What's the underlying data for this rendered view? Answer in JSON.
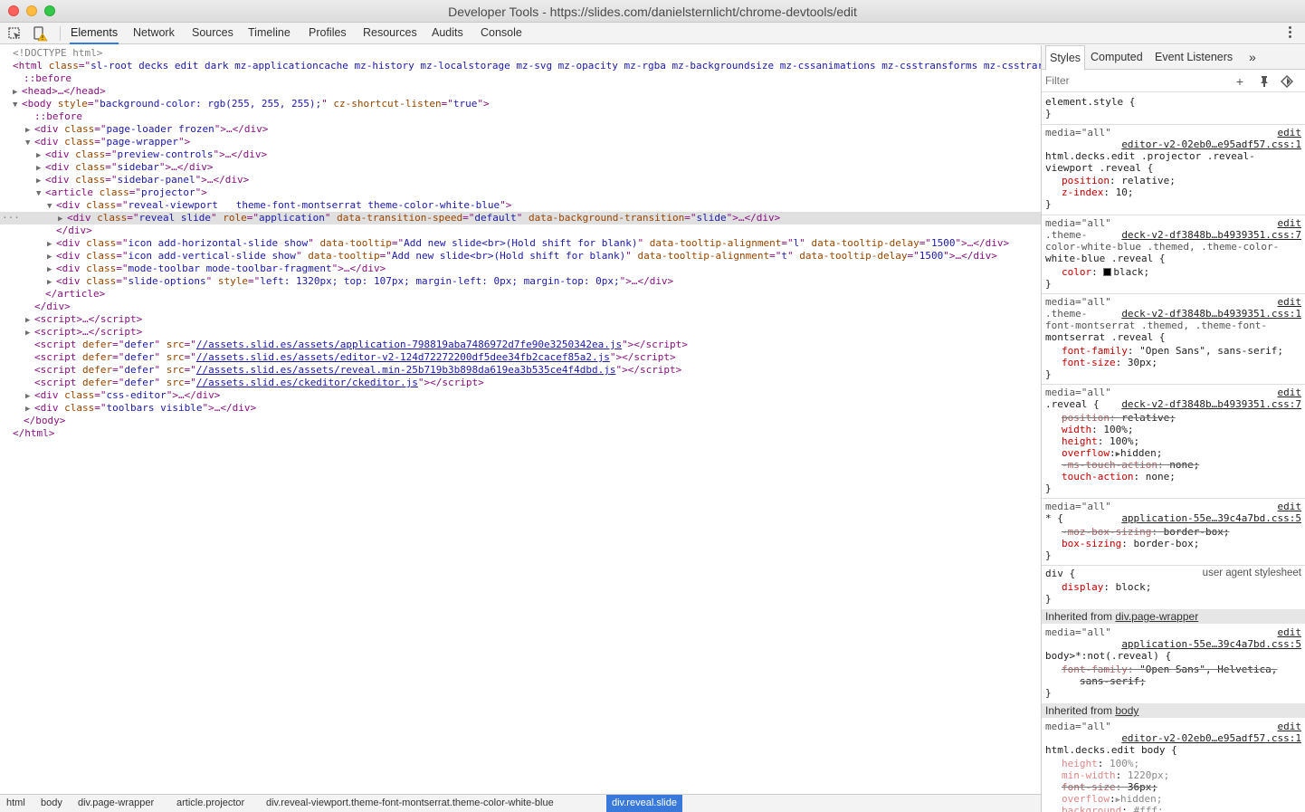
{
  "window": {
    "title": "Developer Tools - https://slides.com/danielsternlicht/chrome-devtools/edit"
  },
  "toolbar": {
    "tabs": [
      "Elements",
      "Network",
      "Sources",
      "Timeline",
      "Profiles",
      "Resources",
      "Audits",
      "Console"
    ],
    "active_tab": "Elements"
  },
  "dom": {
    "doctype": "<!DOCTYPE html>",
    "html_class": "sl-root decks edit dark mz-applicationcache mz-history mz-localstorage mz-svg mz-opacity mz-rgba mz-backgroundsize mz-cssanimations mz-csstransforms mz-csstrar",
    "before": "::before",
    "body_style": "background-color: rgb(255, 255, 255);",
    "body_attr2_name": "cz-shortcut-listen",
    "body_attr2_value": "true",
    "page_loader_class": "page-loader frozen",
    "page_wrapper_class": "page-wrapper",
    "preview_controls_class": "preview-controls",
    "sidebar_class": "sidebar",
    "sidebar_panel_class": "sidebar-panel",
    "projector_class": "projector",
    "viewport_class": "reveal-viewport   theme-font-montserrat theme-color-white-blue",
    "reveal_slide": {
      "class": "reveal slide",
      "role": "application",
      "transition_speed": "default",
      "bg_transition": "slide"
    },
    "add_horizontal": {
      "class": "icon add-horizontal-slide show",
      "tooltip": "Add new slide<br>(Hold shift for blank)",
      "alignment": "l",
      "delay": "1500"
    },
    "add_vertical": {
      "class": "icon add-vertical-slide show",
      "tooltip": "Add new slide<br>(Hold shift for blank)",
      "alignment": "t",
      "delay": "1500"
    },
    "mode_toolbar_class": "mode-toolbar mode-toolbar-fragment",
    "slide_options": {
      "class": "slide-options",
      "style": "left: 1320px; top: 107px; margin-left: 0px; margin-top: 0px;"
    },
    "scripts": [
      "//assets.slid.es/assets/application-798819aba7486972d7fe90e3250342ea.js",
      "//assets.slid.es/assets/editor-v2-124d72272200df5dee34fb2cacef85a2.js",
      "//assets.slid.es/assets/reveal.min-25b719b3b898da619ea3b535ce4f4dbd.js",
      "//assets.slid.es/ckeditor/ckeditor.js"
    ],
    "defer": "defer",
    "css_editor_class": "css-editor",
    "toolbars_class": "toolbars visible"
  },
  "breadcrumbs": [
    "html",
    "body",
    "div.page-wrapper",
    "article.projector",
    "div.reveal-viewport.theme-font-montserrat.theme-color-white-blue",
    "div.reveal.slide"
  ],
  "styles": {
    "tabs": [
      "Styles",
      "Computed",
      "Event Listeners"
    ],
    "more": "»",
    "filter_placeholder": "Filter",
    "element_style": "element.style {",
    "close": "}",
    "media": "media=\"all\"",
    "edit": "edit",
    "ua": "user agent stylesheet",
    "r1": {
      "src": "editor-v2-02eb0…e95adf57.css:1",
      "sel1": "html.decks.edit .projector .reveal-",
      "sel2": "viewport .reveal {",
      "p1n": "position",
      "p1v": "relative;",
      "p2n": "z-index",
      "p2v": "10;"
    },
    "r2": {
      "src": "deck-v2-df3848b…b4939351.css:7",
      "sel1": ".theme-",
      "sel2": "color-white-blue .themed, .theme-color-",
      "sel3": "white-blue .reveal {",
      "p1n": "color",
      "p1v": "black;"
    },
    "r3": {
      "src": "deck-v2-df3848b…b4939351.css:1",
      "sel1": ".theme-",
      "sel2": "font-montserrat .themed, .theme-font-",
      "sel3": "montserrat .reveal {",
      "p1n": "font-family",
      "p1v": "\"Open Sans\", sans-serif;",
      "p2n": "font-size",
      "p2v": "30px;"
    },
    "r4": {
      "src": "deck-v2-df3848b…b4939351.css:7",
      "sel1": ".reveal {",
      "p1n": "position",
      "p1v": "relative;",
      "p2n": "width",
      "p2v": "100%;",
      "p3n": "height",
      "p3v": "100%;",
      "p4n": "overflow",
      "p4v": "hidden;",
      "p5n": "-ms-touch-action",
      "p5v": "none;",
      "p6n": "touch-action",
      "p6v": "none;"
    },
    "r5": {
      "src": "application-55e…39c4a7bd.css:5",
      "sel1": "* {",
      "p1n": "-moz-box-sizing",
      "p1v": "border-box;",
      "p2n": "box-sizing",
      "p2v": "border-box;"
    },
    "r6": {
      "sel1": "div {",
      "p1n": "display",
      "p1v": "block;"
    },
    "inh1_label": "Inherited from ",
    "inh1_link": "div.page-wrapper",
    "r7": {
      "src": "application-55e…39c4a7bd.css:5",
      "sel1": "body>*:not(.reveal) {",
      "p1n": "font-family",
      "p1v": "\"Open Sans\", Helvetica,",
      "p1v2": "sans-serif;"
    },
    "inh2_label": "Inherited from ",
    "inh2_link": "body",
    "r8": {
      "src": "editor-v2-02eb0…e95adf57.css:1",
      "sel1": "html.decks.edit body {",
      "p1n": "height",
      "p1v": "100%;",
      "p2n": "min-width",
      "p2v": "1220px;",
      "p3n": "font-size",
      "p3v": "36px;",
      "p4n": "overflow",
      "p4v": "hidden;",
      "p5n": "background",
      "p5v": "#fff;"
    }
  }
}
